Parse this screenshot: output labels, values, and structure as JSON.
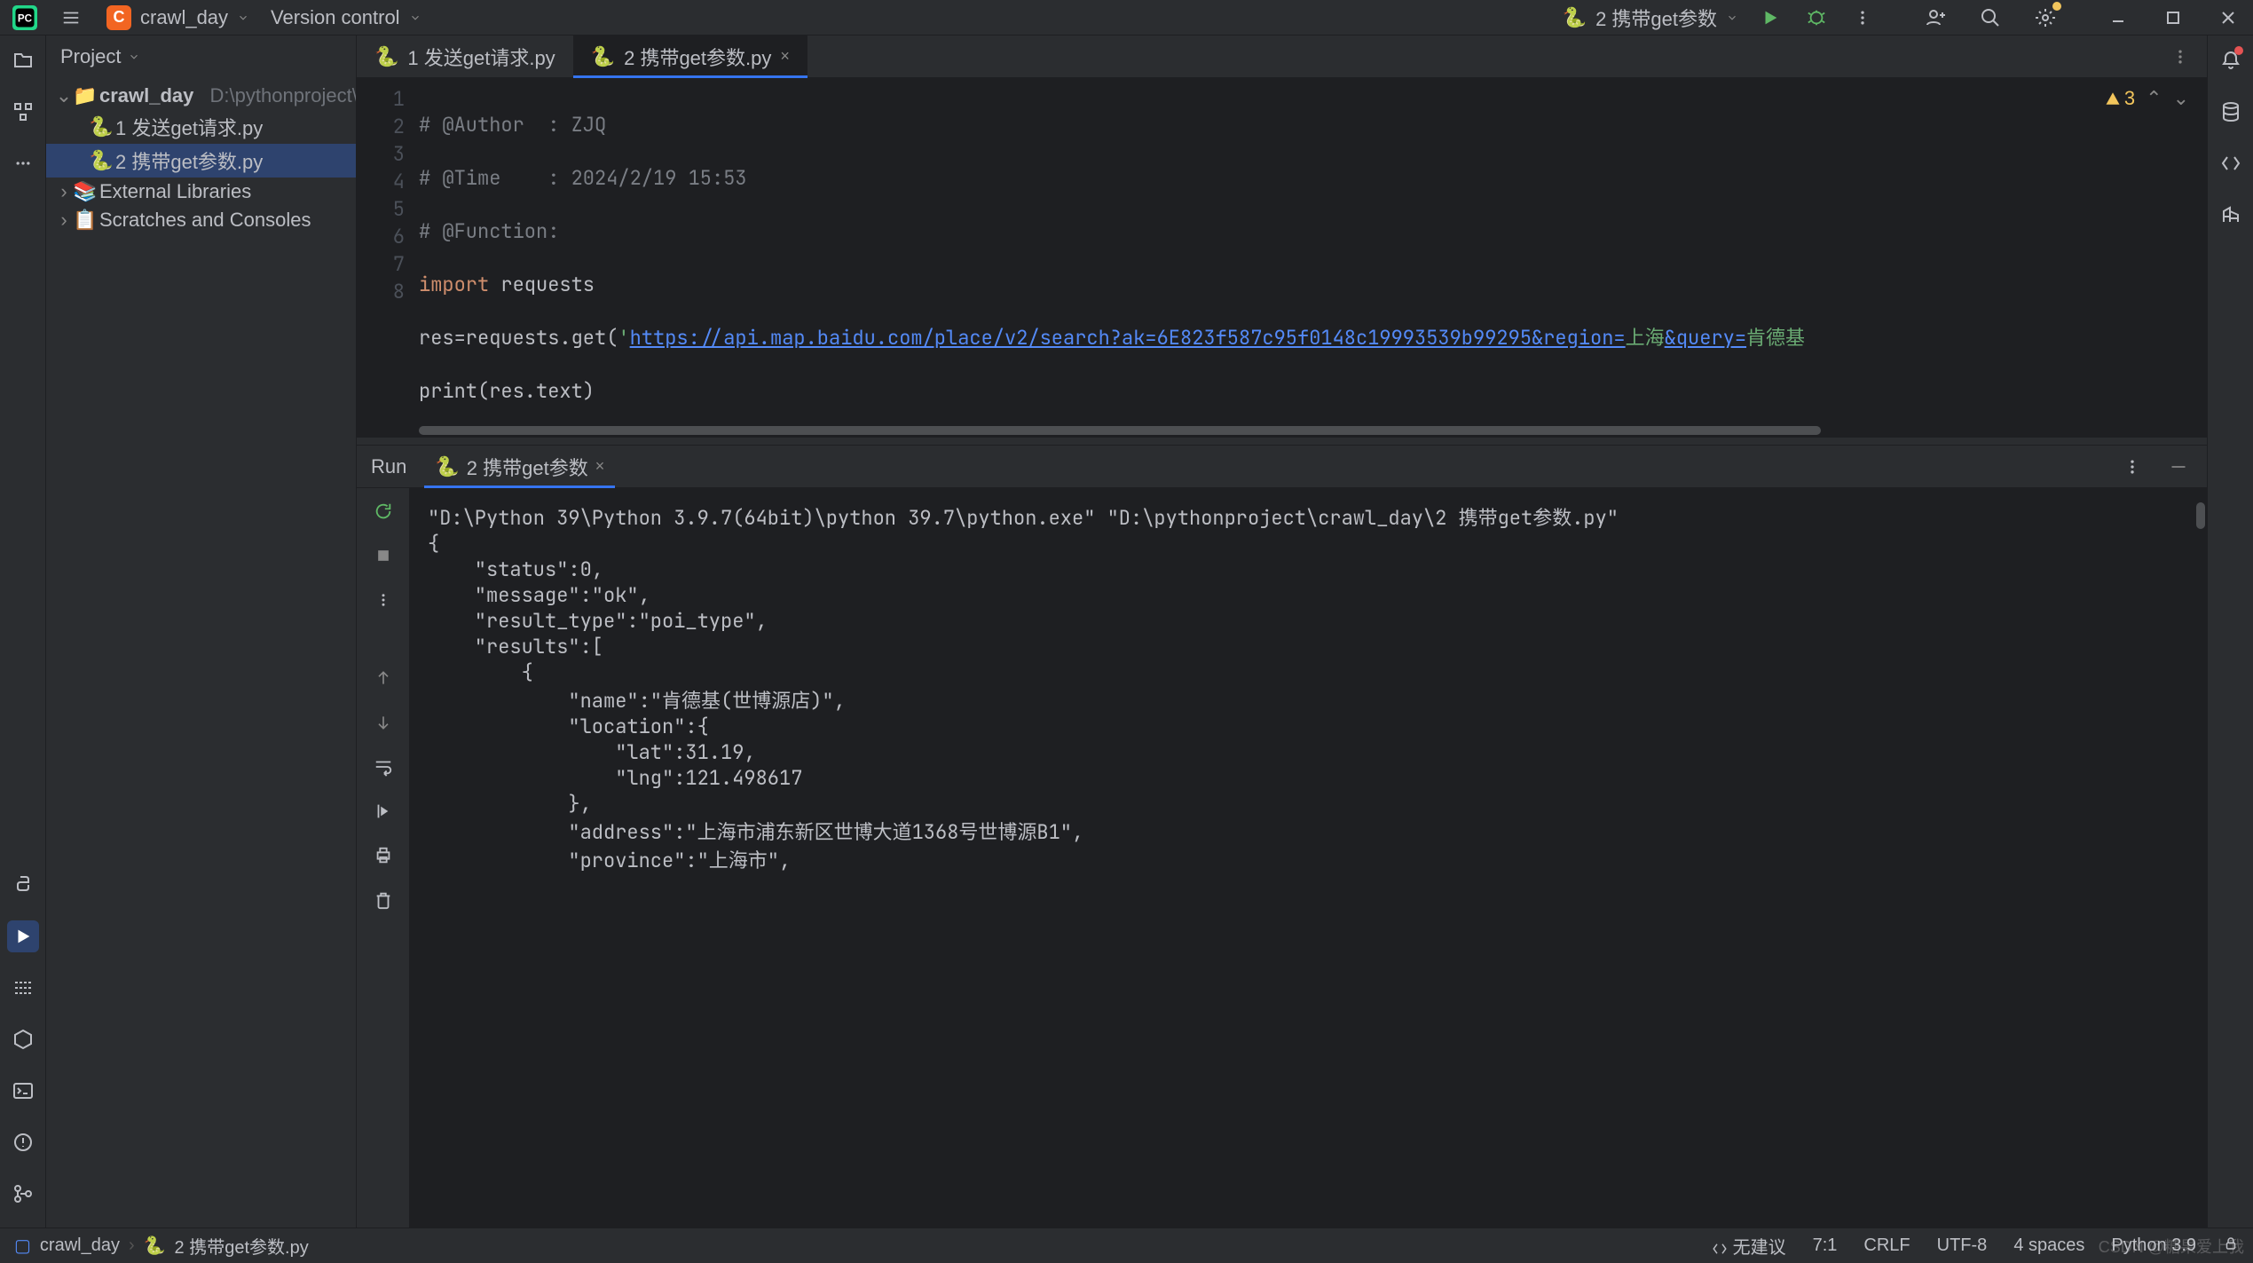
{
  "titlebar": {
    "project_badge": "C",
    "project_name": "crawl_day",
    "vcs_label": "Version control",
    "run_config": "2 携带get参数"
  },
  "project": {
    "header": "Project",
    "root": {
      "name": "crawl_day",
      "path": "D:\\pythonproject\\crawl_day"
    },
    "files": [
      "1 发送get请求.py",
      "2 携带get参数.py"
    ],
    "external": "External Libraries",
    "scratches": "Scratches and Consoles"
  },
  "tabs": [
    {
      "label": "1 发送get请求.py"
    },
    {
      "label": "2 携带get参数.py"
    }
  ],
  "editor": {
    "warning_count": "3",
    "lines": [
      "1",
      "2",
      "3",
      "4",
      "5",
      "6",
      "7",
      "8"
    ],
    "code": {
      "l1_a": "# @Author  : ZJQ",
      "l2_a": "# @Time    : 2024/2/19 15:53",
      "l3_a": "# @Function:",
      "l4_kw": "import",
      "l4_rest": " requests",
      "l5_a": "res=requests.get(",
      "l5_str_open": "'",
      "l5_url": "https://api.map.baidu.com/place/v2/search?ak=6E823f587c95f0148c19993539b99295&region=",
      "l5_cn1": "上海",
      "l5_mid": "&query=",
      "l5_cn2": "肯德基",
      "l6_a": "print(res.text)"
    }
  },
  "run": {
    "title": "Run",
    "tab": "2 携带get参数",
    "console": "\"D:\\Python 39\\Python 3.9.7(64bit)\\python 39.7\\python.exe\" \"D:\\pythonproject\\crawl_day\\2 携带get参数.py\"\n{\n    \"status\":0,\n    \"message\":\"ok\",\n    \"result_type\":\"poi_type\",\n    \"results\":[\n        {\n            \"name\":\"肯德基(世博源店)\",\n            \"location\":{\n                \"lat\":31.19,\n                \"lng\":121.498617\n            },\n            \"address\":\"上海市浦东新区世博大道1368号世博源B1\",\n            \"province\":\"上海市\","
  },
  "status": {
    "breadcrumb_root": "crawl_day",
    "breadcrumb_file": "2 携带get参数.py",
    "suggest": "无建议",
    "pos": "7:1",
    "eol": "CRLF",
    "enc": "UTF-8",
    "indent": "4 spaces",
    "sdk": "Python 3.9"
  },
  "watermark": "CSDN @糖果爱上我"
}
